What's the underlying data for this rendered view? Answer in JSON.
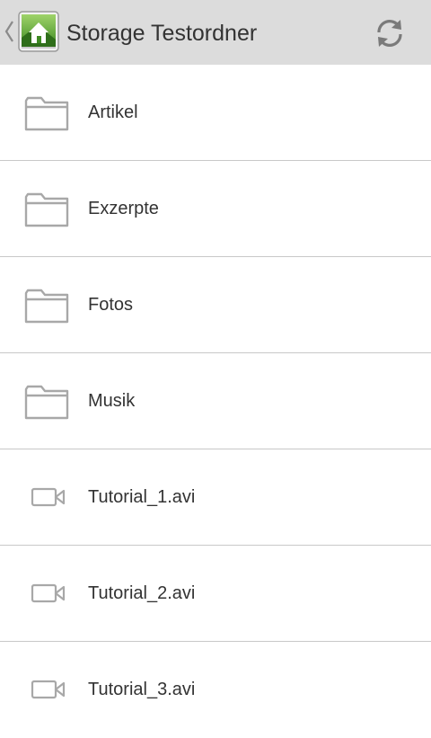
{
  "action_bar": {
    "title": "Storage Testordner",
    "up_icon": "chevron-left-icon",
    "app_icon": "home-landscape-icon",
    "refresh_icon": "refresh-icon",
    "background_color": "#dcdcdc"
  },
  "items": [
    {
      "label": "Artikel",
      "type": "folder",
      "icon": "folder-icon"
    },
    {
      "label": "Exzerpte",
      "type": "folder",
      "icon": "folder-icon"
    },
    {
      "label": "Fotos",
      "type": "folder",
      "icon": "folder-icon"
    },
    {
      "label": "Musik",
      "type": "folder",
      "icon": "folder-icon"
    },
    {
      "label": "Tutorial_1.avi",
      "type": "video",
      "icon": "video-camera-icon"
    },
    {
      "label": "Tutorial_2.avi",
      "type": "video",
      "icon": "video-camera-icon"
    },
    {
      "label": "Tutorial_3.avi",
      "type": "video",
      "icon": "video-camera-icon"
    }
  ]
}
